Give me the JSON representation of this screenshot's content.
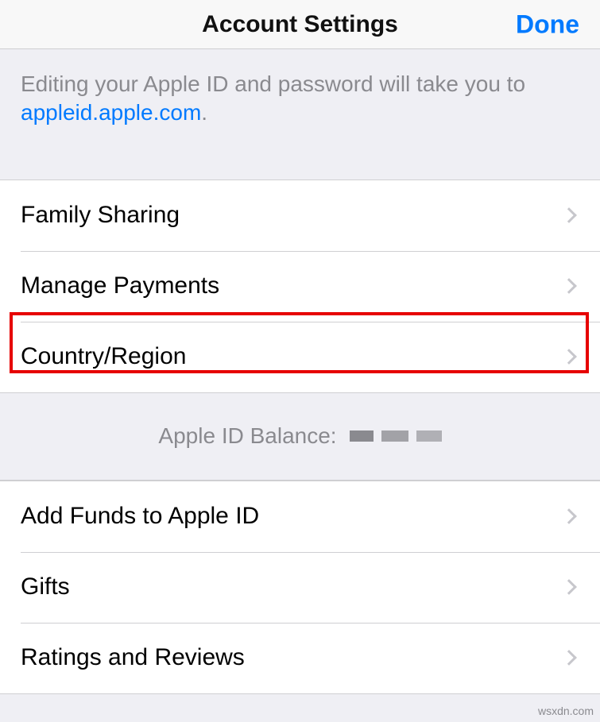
{
  "header": {
    "title": "Account Settings",
    "done_label": "Done"
  },
  "info": {
    "text_prefix": "Editing your Apple ID and password will take you to ",
    "link_text": "appleid.apple.com",
    "text_suffix": "."
  },
  "section1": {
    "items": [
      {
        "label": "Family Sharing"
      },
      {
        "label": "Manage Payments"
      },
      {
        "label": "Country/Region"
      }
    ]
  },
  "balance": {
    "label": "Apple ID Balance:"
  },
  "section2": {
    "items": [
      {
        "label": "Add Funds to Apple ID"
      },
      {
        "label": "Gifts"
      },
      {
        "label": "Ratings and Reviews"
      }
    ]
  },
  "watermark": "wsxdn.com"
}
